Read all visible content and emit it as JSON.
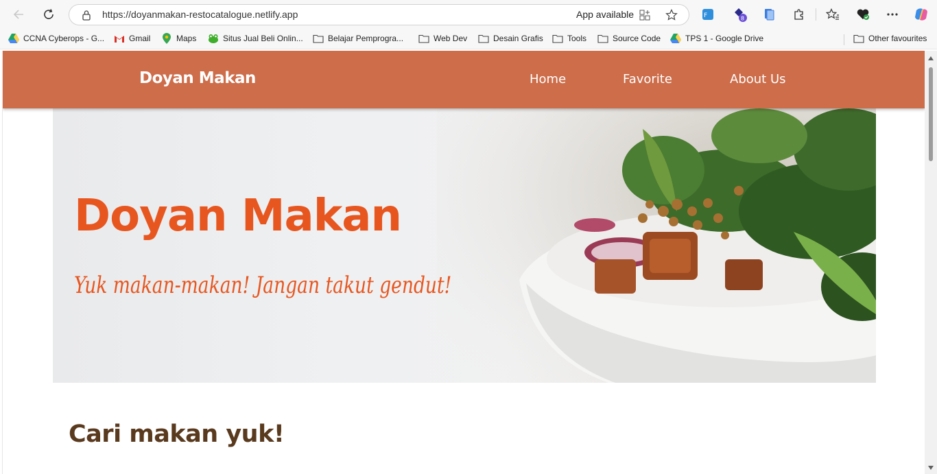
{
  "browser": {
    "url": "https://doyanmakan-restocatalogue.netlify.app",
    "app_available_label": "App available",
    "extension_badge": "8",
    "bookmarks": [
      {
        "label": "CCNA Cyberops - G...",
        "icon": "google-drive-icon"
      },
      {
        "label": "Gmail",
        "icon": "gmail-icon"
      },
      {
        "label": "Maps",
        "icon": "maps-pin-icon"
      },
      {
        "label": "Situs Jual Beli Onlin...",
        "icon": "frog-icon"
      },
      {
        "label": "Belajar Pemprogra...",
        "icon": "folder-icon"
      },
      {
        "label": "Web Dev",
        "icon": "folder-icon"
      },
      {
        "label": "Desain Grafis",
        "icon": "folder-icon"
      },
      {
        "label": "Tools",
        "icon": "folder-icon"
      },
      {
        "label": "Source Code",
        "icon": "folder-icon"
      },
      {
        "label": "TPS 1 - Google Drive",
        "icon": "google-drive-icon"
      }
    ],
    "other_favourites": "Other favourites"
  },
  "site": {
    "brand": "Doyan Makan",
    "nav": [
      "Home",
      "Favorite",
      "About Us"
    ],
    "hero": {
      "title": "Doyan Makan",
      "tagline": "Yuk makan-makan! Jangan takut gendut!"
    },
    "section_title": "Cari makan yuk!"
  },
  "colors": {
    "app_bar": "#cd6d4a",
    "hero_text": "#e8561f",
    "section_title": "#5a3a1e"
  }
}
